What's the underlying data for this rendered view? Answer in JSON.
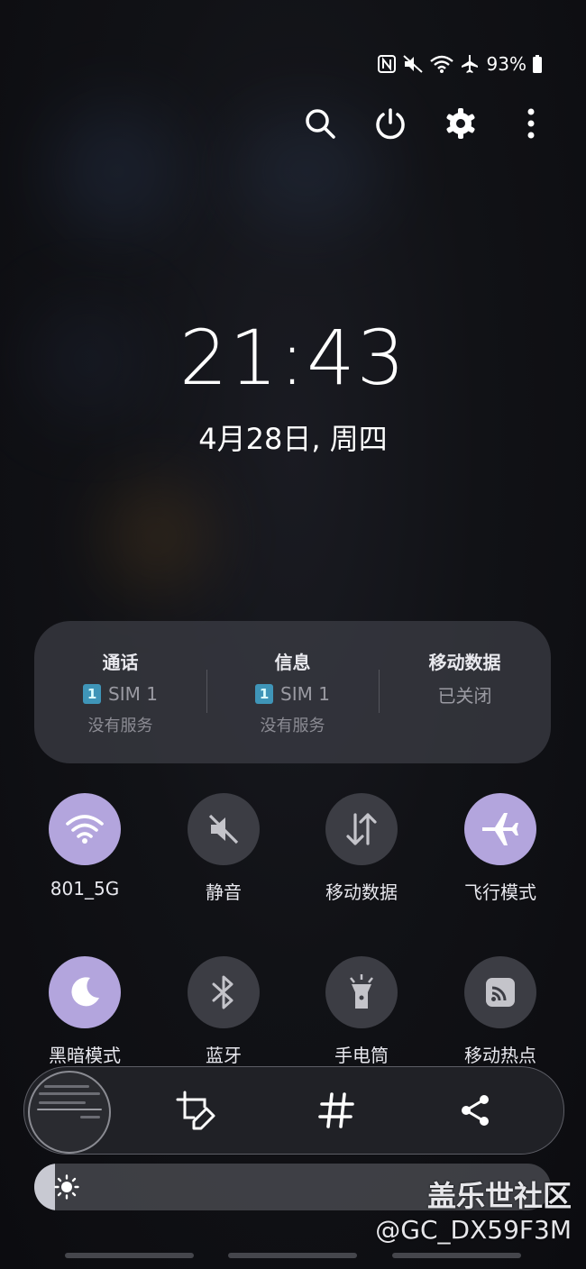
{
  "status_bar": {
    "icons": [
      "nfc-icon",
      "mute-icon",
      "wifi-icon",
      "airplane-icon"
    ],
    "battery": "93%"
  },
  "top_actions": [
    "search-icon",
    "power-icon",
    "gear-icon",
    "more-icon"
  ],
  "clock": {
    "time": "21:43",
    "date": "4月28日, 周四"
  },
  "sim_panel": [
    {
      "title": "通话",
      "badge": "1",
      "line": "SIM 1",
      "sub": "没有服务"
    },
    {
      "title": "信息",
      "badge": "1",
      "line": "SIM 1",
      "sub": "没有服务"
    },
    {
      "title": "移动数据",
      "line": "已关闭"
    }
  ],
  "tiles": [
    {
      "label": "801_5G",
      "icon": "wifi-icon",
      "active": true
    },
    {
      "label": "静音",
      "icon": "mute-icon",
      "active": false
    },
    {
      "label": "移动数据",
      "icon": "data-arrows-icon",
      "active": false
    },
    {
      "label": "飞行模式",
      "icon": "airplane-icon",
      "active": true
    },
    {
      "label": "黑暗模式",
      "icon": "moon-icon",
      "active": true
    },
    {
      "label": "蓝牙",
      "icon": "bluetooth-icon",
      "active": false
    },
    {
      "label": "手电筒",
      "icon": "flashlight-icon",
      "active": false
    },
    {
      "label": "移动热点",
      "icon": "hotspot-icon",
      "active": false
    }
  ],
  "screenshot_toolbar": {
    "tools": [
      "crop-edit-icon",
      "hashtag-icon",
      "share-icon"
    ]
  },
  "brightness": {
    "level": 0.04
  },
  "watermark": {
    "line1": "盖乐世社区",
    "line2": "@GC_DX59F3M"
  },
  "colors": {
    "active_tile": "#b3a5dd",
    "inactive_tile": "#3c3d44",
    "sim_badge": "#3f95b8"
  }
}
